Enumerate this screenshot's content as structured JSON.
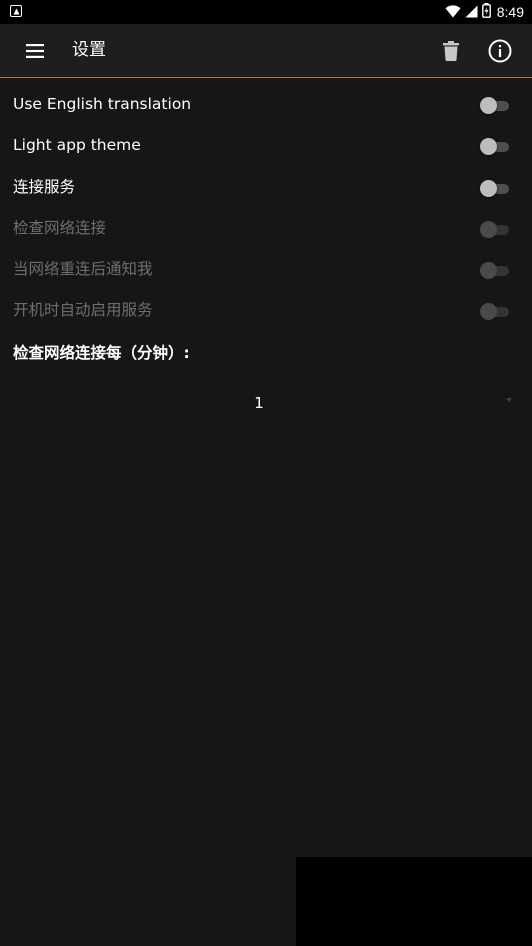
{
  "status_bar": {
    "time": "8:49",
    "icons": [
      "notification-icon",
      "wifi-icon",
      "cell-signal-icon",
      "battery-icon"
    ]
  },
  "app_bar": {
    "title": "设置",
    "accent_color": "#c8742c",
    "icons": [
      "menu-icon",
      "delete-icon",
      "info-icon"
    ]
  },
  "settings": {
    "items": [
      {
        "label": "Use English translation",
        "enabled": true,
        "checked": false
      },
      {
        "label": "Light app theme",
        "enabled": true,
        "checked": false
      },
      {
        "label": "连接服务",
        "enabled": true,
        "checked": false
      },
      {
        "label": "检查网络连接",
        "enabled": false,
        "checked": false
      },
      {
        "label": "当网络重连后通知我",
        "enabled": false,
        "checked": false
      },
      {
        "label": "开机时自动启用服务",
        "enabled": false,
        "checked": false
      }
    ],
    "interval_label": "检查网络连接每（分钟）:",
    "interval_value": "1"
  }
}
